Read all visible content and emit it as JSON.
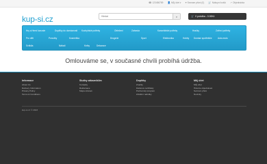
{
  "topbar": {
    "links": [
      {
        "icon": "phone-icon",
        "glyph": "☎",
        "label": "123456789"
      },
      {
        "icon": "user-icon",
        "glyph": "👤",
        "label": "Můj účet ▾"
      },
      {
        "icon": "heart-icon",
        "glyph": "♥",
        "label": "Seznam přání (0)"
      },
      {
        "icon": "cart-icon",
        "glyph": "🛒",
        "label": "Nákupní košík"
      },
      {
        "icon": "share-icon",
        "glyph": "↗",
        "label": "Objednávka"
      }
    ]
  },
  "header": {
    "logo": "kup-si.cz",
    "search_placeholder": "Hledat",
    "cart_label": "0 položka - 0.00Kč"
  },
  "menu": {
    "row1": [
      "Hry a Herní konzole",
      "Doplňky do domácnosti",
      "Kuchyňské potřeby",
      "Oblečení",
      "Zahrada",
      "Kancelářské potřeby",
      "Hračky",
      "Zvířecí potřeby"
    ],
    "row2": [
      "Pro děti",
      "Ponožky",
      "Kosmetika",
      "Drogerie",
      "Sport",
      "Elektronika",
      "Hobby",
      "Domácí spotřebiče",
      "Auto-moto"
    ],
    "row3": [
      "Svítidla",
      "Nářadí",
      "Knihy",
      "Dekorace"
    ]
  },
  "notice": "Omlouváme se, v současné chvíli probíhá údržba.",
  "footer": {
    "columns": [
      {
        "title": "Informace",
        "links": [
          "About Us",
          "Delivery Information",
          "Privacy Policy",
          "Terms & Conditions"
        ]
      },
      {
        "title": "Služby zákazníkům",
        "links": [
          "Kontakty",
          "Reklamace",
          "Mapa stránek"
        ]
      },
      {
        "title": "Doplňky",
        "links": [
          "Značky",
          "Dárkové certifikáty",
          "Partnerský program",
          "Zvláštní nabídky"
        ]
      },
      {
        "title": "Můj účet",
        "links": [
          "Můj účet",
          "Historie objednávek",
          "Seznam přání",
          "Novinky"
        ]
      }
    ],
    "copyright": "kup-si.cz © 2023"
  }
}
